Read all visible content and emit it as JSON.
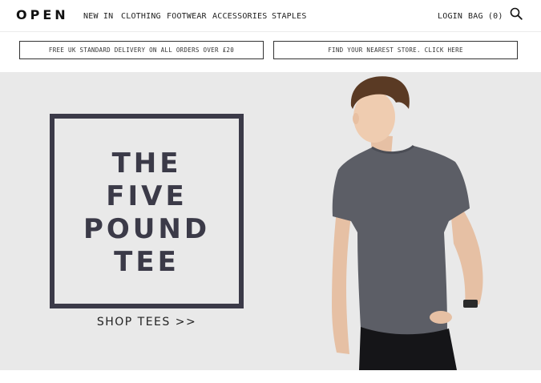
{
  "header": {
    "logo": "OPEN",
    "nav": [
      "NEW IN",
      "CLOTHING",
      "FOOTWEAR",
      "ACCESSORIES",
      "STAPLES"
    ],
    "login": "LOGIN",
    "bag": "BAG (0)"
  },
  "promos": {
    "delivery": "FREE UK STANDARD DELIVERY ON ALL ORDERS OVER £20",
    "store": "FIND YOUR NEAREST STORE. CLICK HERE"
  },
  "hero": {
    "headline": [
      "THE",
      "FIVE",
      "POUND",
      "TEE"
    ],
    "cta": "SHOP TEES >>",
    "accent_color": "#3b3a48",
    "background_color": "#e9e9e9"
  }
}
